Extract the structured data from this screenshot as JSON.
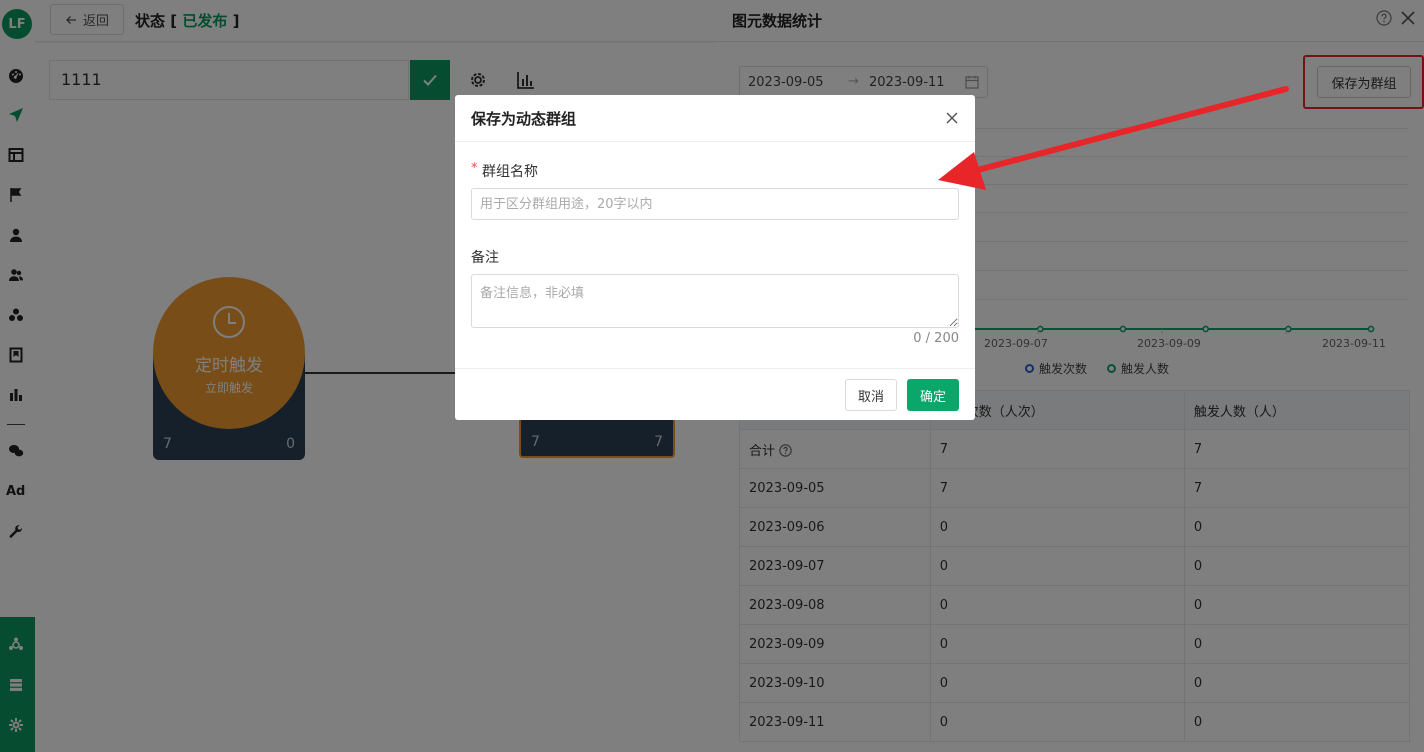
{
  "rail": {
    "logo": "LF",
    "ad_label": "Ad",
    "icons": [
      "dashboard-icon",
      "send-icon",
      "layout-icon",
      "flag-icon",
      "user-icon",
      "users-icon",
      "segments-icon",
      "bookmark-icon",
      "bar-chart-icon",
      "wechat-icon",
      "wrench-icon"
    ],
    "bottom_icons": [
      "team-icon",
      "server-icon",
      "gear-icon"
    ]
  },
  "topbar": {
    "back_label": "返回",
    "status_prefix": "状态 [",
    "status_value": "已发布",
    "status_suffix": "]"
  },
  "canvas": {
    "flow_name": "1111",
    "node1": {
      "title": "定时触发",
      "subtitle": "立即触发",
      "count_left": "7",
      "count_right": "0"
    },
    "node2": {
      "count_left": "7",
      "count_right": "7"
    }
  },
  "drawer": {
    "title": "图元数据统计",
    "date_start": "2023-09-05",
    "date_end": "2023-09-11",
    "save_group_label": "保存为群组",
    "legend": [
      {
        "name": "触发次数",
        "color": "#1e62d6"
      },
      {
        "name": "触发人数",
        "color": "#0aa66a"
      }
    ],
    "table": {
      "headers": [
        "",
        "触发次数（人次）",
        "触发人数（人）"
      ],
      "total_label": "合计",
      "total": [
        "7",
        "7"
      ],
      "rows": [
        [
          "2023-09-05",
          "7",
          "7"
        ],
        [
          "2023-09-06",
          "0",
          "0"
        ],
        [
          "2023-09-07",
          "0",
          "0"
        ],
        [
          "2023-09-08",
          "0",
          "0"
        ],
        [
          "2023-09-09",
          "0",
          "0"
        ],
        [
          "2023-09-10",
          "0",
          "0"
        ],
        [
          "2023-09-11",
          "0",
          "0"
        ]
      ]
    }
  },
  "chart_data": {
    "type": "line",
    "x": [
      "2023-09-05",
      "2023-09-06",
      "2023-09-07",
      "2023-09-08",
      "2023-09-09",
      "2023-09-10",
      "2023-09-11"
    ],
    "x_tick_labels_visible": [
      "2023-09-07",
      "2023-09-09",
      "2023-09-11"
    ],
    "series": [
      {
        "name": "触发次数",
        "values": [
          7,
          0,
          0,
          0,
          0,
          0,
          0
        ]
      },
      {
        "name": "触发人数",
        "values": [
          7,
          0,
          0,
          0,
          0,
          0,
          0
        ]
      }
    ],
    "grid": true,
    "legend_position": "bottom"
  },
  "modal": {
    "title": "保存为动态群组",
    "name_label": "群组名称",
    "required_mark": "*",
    "name_placeholder": "用于区分群组用途，20字以内",
    "name_value": "",
    "remark_label": "备注",
    "remark_placeholder": "备注信息，非必填",
    "remark_value": "",
    "char_count": "0 / 200",
    "cancel_label": "取消",
    "ok_label": "确定"
  }
}
